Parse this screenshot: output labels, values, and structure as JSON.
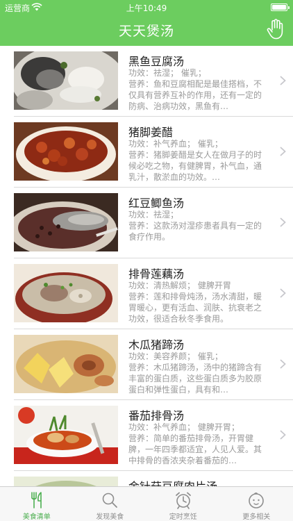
{
  "status_bar": {
    "carrier": "运营商",
    "time": "上午10:49"
  },
  "nav": {
    "title": "天天煲汤",
    "right_icon": "hand-pointer-icon"
  },
  "recipes": [
    {
      "name": "黑鱼豆腐汤",
      "effect": "功效：祛湿；  催乳；",
      "description": "营养：鱼和豆腐相配是最佳搭档，不仅具有营养互补的作用，还有一定的防病、治病功效，黑鱼有…"
    },
    {
      "name": "猪脚姜醋",
      "effect": "功效：补气养血；  催乳；",
      "description": "营养：猪脚姜醋是女人在做月子的时候必吃之物，有健脾胃，补气血，通乳汁，散淤血的功效。…"
    },
    {
      "name": "红豆鲫鱼汤",
      "effect": "功效：祛湿；",
      "description": "营养：这款汤对湿疹患者具有一定的食疗作用。"
    },
    {
      "name": "排骨莲藕汤",
      "effect": "功效：清热解烦；  健脾开胃",
      "description": "营养：莲和排骨炖汤，汤水清甜，暖胃暖心，更有活血、润肤、抗衰老之功效，很适合秋冬季食用。"
    },
    {
      "name": "木瓜猪蹄汤",
      "effect": "功效：美容养颜；  催乳；",
      "description": "营养：木瓜猪蹄汤，汤中的猪蹄含有丰富的蛋白质，这些蛋白质多为胶原蛋白和弹性蛋白，具有和…"
    },
    {
      "name": "番茄排骨汤",
      "effect": "功效：补气养血；  健脾开胃；",
      "description": "营养：简单的番茄排骨汤，开胃健脾，一年四季都适宜，人见人爱。其中排骨的香浓夹杂着番茄的…"
    },
    {
      "name": "金针菇豆腐肉片汤",
      "effect": "",
      "description": ""
    }
  ],
  "tabs": [
    {
      "label": "美食清单",
      "icon": "fork-knife-icon",
      "active": true
    },
    {
      "label": "发现美食",
      "icon": "search-icon",
      "active": false
    },
    {
      "label": "定时烹饪",
      "icon": "alarm-clock-icon",
      "active": false
    },
    {
      "label": "更多相关",
      "icon": "baby-face-icon",
      "active": false
    }
  ],
  "colors": {
    "accent": "#6ccd5f",
    "tab_active": "#4caf50",
    "text_secondary": "#9a9a9a"
  }
}
